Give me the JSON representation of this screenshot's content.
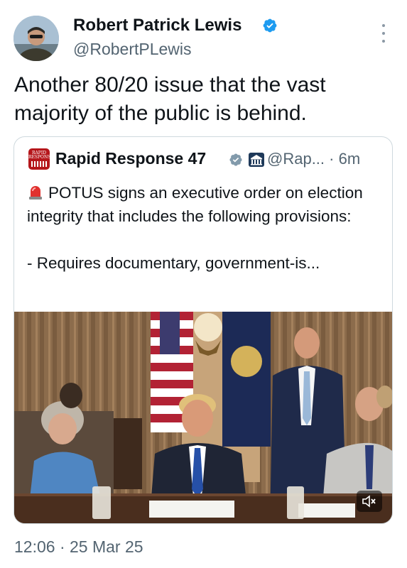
{
  "tweet": {
    "author": {
      "name": "Robert Patrick Lewis",
      "handle": "@RobertPLewis",
      "verified": true,
      "avatar_icon": "profile-photo"
    },
    "text": "Another 80/20 issue that the vast majority of the public is behind.",
    "timestamp": "12:06 · 25 Mar 25",
    "more_icon": "more-vertical-icon"
  },
  "quote": {
    "author": {
      "name": "Rapid Response 47",
      "handle": "@Rap...",
      "time": "· 6m",
      "verified": true,
      "affiliate_badge": "white-house-icon",
      "logo_text": "RAPID RESPONSE"
    },
    "text_emoji": "siren-icon",
    "text": "POTUS signs an executive order on election integrity that includes the following provisions:\n\n- Requires documentary, government-is...",
    "media": {
      "type": "video",
      "mute_icon": "speaker-muted-icon"
    }
  },
  "colors": {
    "text_primary": "#0f1419",
    "text_secondary": "#536471",
    "verified_blue": "#1d9bf0",
    "verified_gray": "#829aab",
    "border": "#cfd9de"
  }
}
